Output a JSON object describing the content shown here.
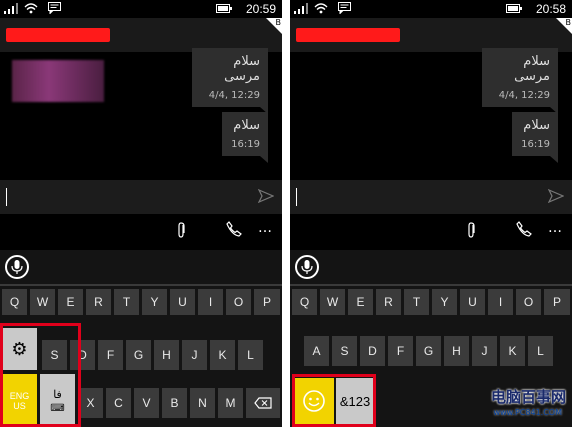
{
  "left_phone": {
    "status": {
      "time": "20:59",
      "fold_badge": "B"
    },
    "messages": [
      {
        "text": "سلام مرسی",
        "time": "4/4, 12:29"
      },
      {
        "text": "سلام",
        "time": "16:19"
      }
    ],
    "keyboard": {
      "row1": [
        "Q",
        "W",
        "E",
        "R",
        "T",
        "Y",
        "U",
        "I",
        "O",
        "P"
      ],
      "row2_visible": [
        "S",
        "D",
        "F",
        "G",
        "H",
        "J",
        "K",
        "L"
      ],
      "row3_visible": [
        "X",
        "C",
        "V",
        "B",
        "N",
        "M"
      ],
      "lang_key": {
        "line1": "ENG",
        "line2": "US"
      },
      "fa_key": "فا"
    }
  },
  "right_phone": {
    "status": {
      "time": "20:58",
      "fold_badge": "B"
    },
    "messages": [
      {
        "text": "سلام مرسی",
        "time": "4/4, 12:29"
      },
      {
        "text": "سلام",
        "time": "16:19"
      }
    ],
    "keyboard": {
      "row1": [
        "Q",
        "W",
        "E",
        "R",
        "T",
        "Y",
        "U",
        "I",
        "O",
        "P"
      ],
      "row2_visible": [
        "A",
        "S",
        "D",
        "F",
        "G",
        "H",
        "J",
        "K",
        "L"
      ],
      "symbols_key": "&123"
    }
  },
  "colors": {
    "highlight_red": "#e0001b",
    "accent_yellow": "#f2d300",
    "contact_red": "#ff1a1a"
  },
  "watermark": {
    "brand": "电脑百事网",
    "url": "www.PC841.COM"
  }
}
